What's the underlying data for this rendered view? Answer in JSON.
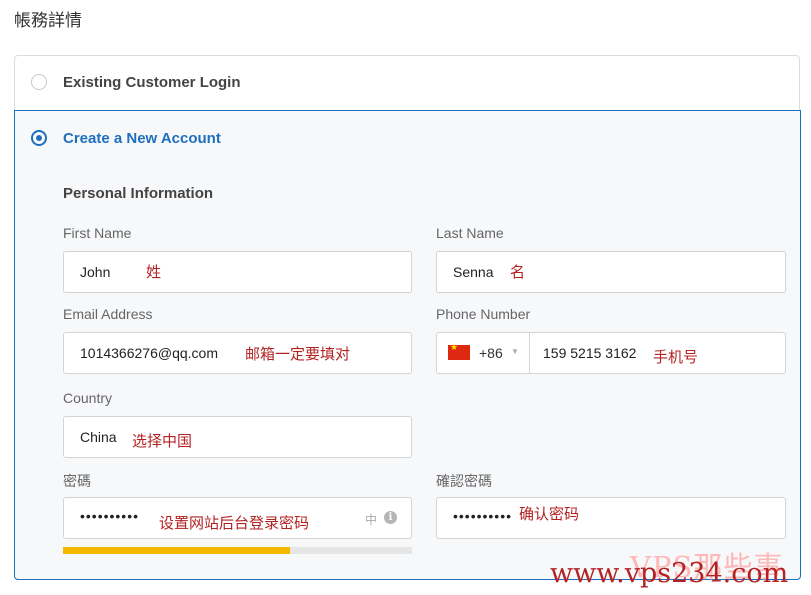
{
  "page": {
    "title": "帳務詳情"
  },
  "options": {
    "existing": {
      "label": "Existing Customer Login",
      "selected": false
    },
    "new": {
      "label": "Create a New Account",
      "selected": true
    }
  },
  "personal": {
    "heading": "Personal Information",
    "first_name": {
      "label": "First Name",
      "value": "John",
      "note": "姓"
    },
    "last_name": {
      "label": "Last Name",
      "value": "Senna",
      "note": "名"
    },
    "email": {
      "label": "Email Address",
      "value": "1014366276@qq.com",
      "note": "邮箱一定要填对"
    },
    "phone": {
      "label": "Phone Number",
      "dial_code": "+86",
      "flag": "china-flag-icon",
      "value": "159 5215 3162",
      "note": "手机号"
    },
    "country": {
      "label": "Country",
      "value": "China",
      "note": "选择中国"
    },
    "password": {
      "label": "密碼",
      "masked": "••••••••••",
      "note": "设置网站后台登录密码",
      "ime_indicator": "中",
      "strength": 0.65,
      "strength_color": "#f5b800"
    },
    "confirm_password": {
      "label": "確認密碼",
      "masked": "••••••••••",
      "note": "确认密码"
    }
  },
  "colors": {
    "accent": "#1e6fbe",
    "annotation": "#b32222"
  },
  "watermark": {
    "brand": "VPS那些事",
    "url": "www.vps234.com"
  }
}
